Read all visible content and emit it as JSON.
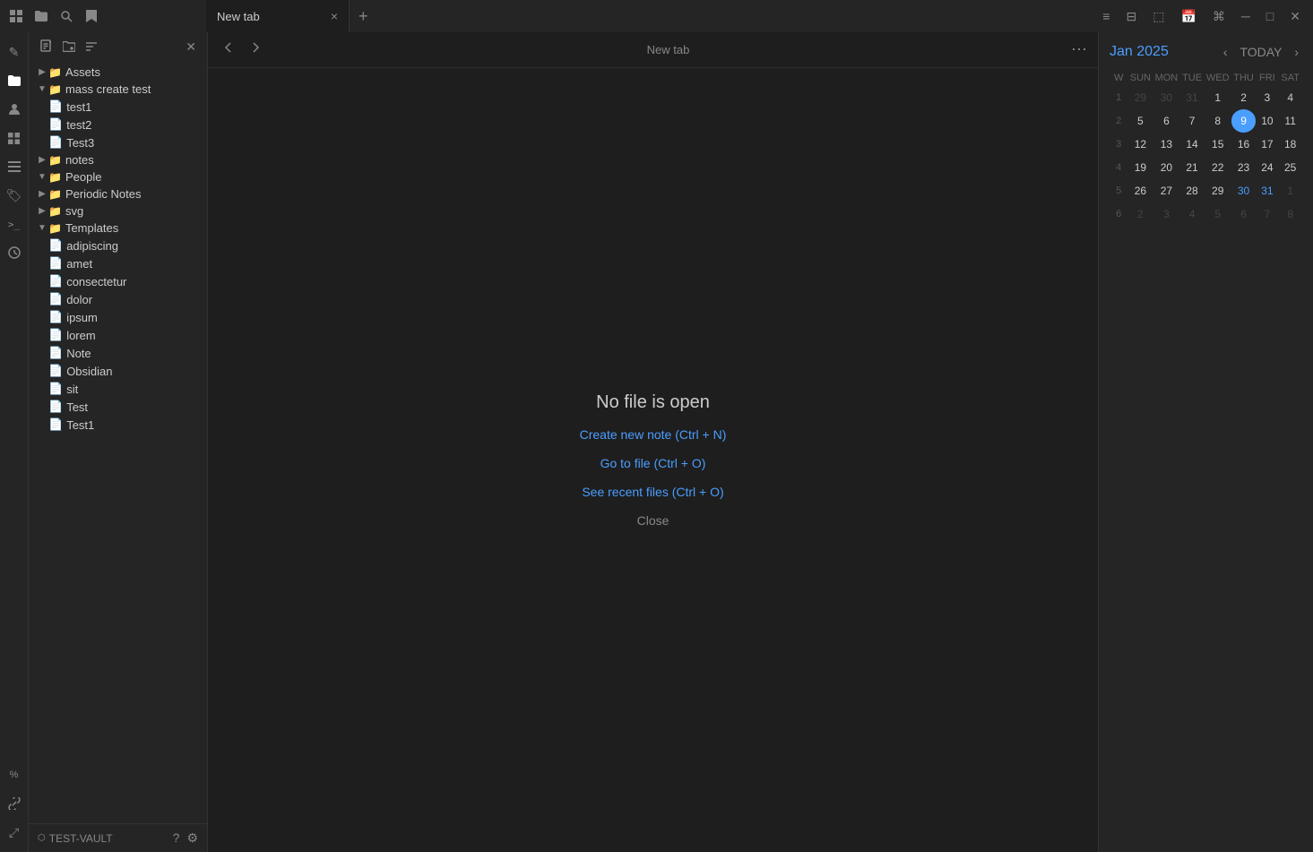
{
  "titlebar": {
    "icons": [
      "grid-icon",
      "folder-icon",
      "search-icon",
      "bookmark-icon"
    ],
    "tab": {
      "label": "New tab",
      "close": "×"
    },
    "add_tab": "+",
    "right_icons": [
      "list-icon",
      "layout-icon",
      "window-icon",
      "calendar-icon",
      "settings-icon",
      "minimize-icon",
      "maximize-icon",
      "close-icon"
    ]
  },
  "icon_sidebar": {
    "items": [
      {
        "name": "edit-icon",
        "symbol": "✎"
      },
      {
        "name": "folder-nav-icon",
        "symbol": "📁"
      },
      {
        "name": "people-icon",
        "symbol": "👤"
      },
      {
        "name": "grid-nav-icon",
        "symbol": "⊞"
      },
      {
        "name": "notes-icon",
        "symbol": "📋"
      },
      {
        "name": "tag-icon",
        "symbol": "🏷"
      },
      {
        "name": "terminal-icon",
        "symbol": ">_"
      },
      {
        "name": "clock-icon",
        "symbol": "⏰"
      },
      {
        "name": "percent-icon",
        "symbol": "%"
      },
      {
        "name": "link-icon",
        "symbol": "🔗"
      },
      {
        "name": "expand-icon",
        "symbol": "⤢"
      }
    ]
  },
  "sidebar": {
    "toolbar": {
      "new_note": "new-note-button",
      "new_folder": "new-folder-button",
      "sort": "sort-button",
      "close": "close-button"
    },
    "tree": [
      {
        "id": "assets",
        "label": "Assets",
        "type": "folder",
        "indent": 0,
        "collapsed": true
      },
      {
        "id": "mass-create-test",
        "label": "mass create test",
        "type": "folder",
        "indent": 0,
        "collapsed": false
      },
      {
        "id": "test1",
        "label": "test1",
        "type": "file",
        "indent": 1
      },
      {
        "id": "test2",
        "label": "test2",
        "type": "file",
        "indent": 1
      },
      {
        "id": "test3",
        "label": "Test3",
        "type": "file",
        "indent": 1
      },
      {
        "id": "notes",
        "label": "notes",
        "type": "folder",
        "indent": 0,
        "collapsed": true
      },
      {
        "id": "people",
        "label": "People",
        "type": "folder",
        "indent": 0,
        "collapsed": false
      },
      {
        "id": "periodic-notes",
        "label": "Periodic Notes",
        "type": "folder",
        "indent": 0,
        "collapsed": true
      },
      {
        "id": "svg",
        "label": "svg",
        "type": "folder",
        "indent": 0,
        "collapsed": true
      },
      {
        "id": "templates",
        "label": "Templates",
        "type": "folder",
        "indent": 0,
        "collapsed": false
      },
      {
        "id": "adipiscing",
        "label": "adipiscing",
        "type": "file",
        "indent": 1
      },
      {
        "id": "amet",
        "label": "amet",
        "type": "file",
        "indent": 1
      },
      {
        "id": "consectetur",
        "label": "consectetur",
        "type": "file",
        "indent": 1
      },
      {
        "id": "dolor",
        "label": "dolor",
        "type": "file",
        "indent": 1
      },
      {
        "id": "ipsum",
        "label": "ipsum",
        "type": "file",
        "indent": 1
      },
      {
        "id": "lorem",
        "label": "lorem",
        "type": "file",
        "indent": 1
      },
      {
        "id": "note",
        "label": "Note",
        "type": "file",
        "indent": 1
      },
      {
        "id": "obsidian",
        "label": "Obsidian",
        "type": "file",
        "indent": 1
      },
      {
        "id": "sit",
        "label": "sit",
        "type": "file",
        "indent": 1
      },
      {
        "id": "test",
        "label": "Test",
        "type": "file",
        "indent": 1
      },
      {
        "id": "test1b",
        "label": "Test1",
        "type": "file",
        "indent": 1
      }
    ]
  },
  "vault": {
    "name": "TEST-VAULT",
    "help": "help-icon",
    "settings": "settings-icon"
  },
  "content": {
    "tab_title": "New tab",
    "no_file_title": "No file is open",
    "create_new_note": "Create new note (Ctrl + N)",
    "go_to_file": "Go to file (Ctrl + O)",
    "see_recent_files": "See recent files (Ctrl + O)",
    "close": "Close"
  },
  "calendar": {
    "month": "Jan",
    "year": "2025",
    "today_btn": "TODAY",
    "days_header": [
      "W",
      "SUN",
      "MON",
      "TUE",
      "WED",
      "THU",
      "FRI",
      "SAT"
    ],
    "weeks": [
      {
        "week_num": 1,
        "days": [
          {
            "day": 29,
            "dim": true
          },
          {
            "day": 30,
            "dim": true
          },
          {
            "day": 31,
            "dim": true
          },
          {
            "day": 1,
            "current": true
          },
          {
            "day": 2,
            "current": true
          },
          {
            "day": 3,
            "current": true
          },
          {
            "day": 4,
            "current": true
          }
        ]
      },
      {
        "week_num": 2,
        "days": [
          {
            "day": 5,
            "current": true
          },
          {
            "day": 6,
            "current": true
          },
          {
            "day": 7,
            "current": true
          },
          {
            "day": 8,
            "current": true
          },
          {
            "day": 9,
            "current": true,
            "highlight": true
          },
          {
            "day": 10,
            "current": true
          },
          {
            "day": 11,
            "current": true
          }
        ]
      },
      {
        "week_num": 3,
        "days": [
          {
            "day": 12,
            "current": true
          },
          {
            "day": 13,
            "current": true
          },
          {
            "day": 14,
            "current": true
          },
          {
            "day": 15,
            "current": true
          },
          {
            "day": 16,
            "current": true
          },
          {
            "day": 17,
            "current": true
          },
          {
            "day": 18,
            "current": true
          }
        ]
      },
      {
        "week_num": 4,
        "days": [
          {
            "day": 19,
            "current": true
          },
          {
            "day": 20,
            "current": true
          },
          {
            "day": 21,
            "current": true
          },
          {
            "day": 22,
            "current": true
          },
          {
            "day": 23,
            "current": true
          },
          {
            "day": 24,
            "current": true
          },
          {
            "day": 25,
            "current": true
          }
        ]
      },
      {
        "week_num": 5,
        "days": [
          {
            "day": 26,
            "current": true
          },
          {
            "day": 27,
            "current": true
          },
          {
            "day": 28,
            "current": true
          },
          {
            "day": 29,
            "current": true
          },
          {
            "day": 30,
            "current": true,
            "blue": true
          },
          {
            "day": 31,
            "current": true,
            "blue": true
          },
          {
            "day": 1,
            "dim": true
          }
        ]
      },
      {
        "week_num": 6,
        "days": [
          {
            "day": 2,
            "dim": true
          },
          {
            "day": 3,
            "dim": true
          },
          {
            "day": 4,
            "dim": true
          },
          {
            "day": 5,
            "dim": true
          },
          {
            "day": 6,
            "dim": true
          },
          {
            "day": 7,
            "dim": true
          },
          {
            "day": 8,
            "dim": true
          }
        ]
      }
    ]
  }
}
